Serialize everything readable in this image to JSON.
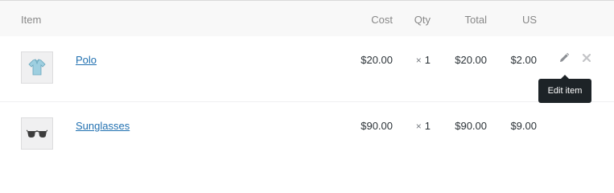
{
  "header": {
    "item": "Item",
    "cost": "Cost",
    "qty": "Qty",
    "total": "Total",
    "tax": "US"
  },
  "rows": [
    {
      "name": "Polo",
      "cost": "$20.00",
      "qty_prefix": "×",
      "qty": "1",
      "total": "$20.00",
      "tax": "$2.00",
      "thumbnail": "polo-shirt"
    },
    {
      "name": "Sunglasses",
      "cost": "$90.00",
      "qty_prefix": "×",
      "qty": "1",
      "total": "$90.00",
      "tax": "$9.00",
      "thumbnail": "sunglasses"
    }
  ],
  "actions": {
    "edit_icon": "pencil-icon",
    "delete_icon": "close-icon"
  },
  "tooltip": {
    "text": "Edit item"
  },
  "colors": {
    "link": "#2271b1",
    "header_bg": "#f8f8f8",
    "tooltip_bg": "#1d2327"
  }
}
